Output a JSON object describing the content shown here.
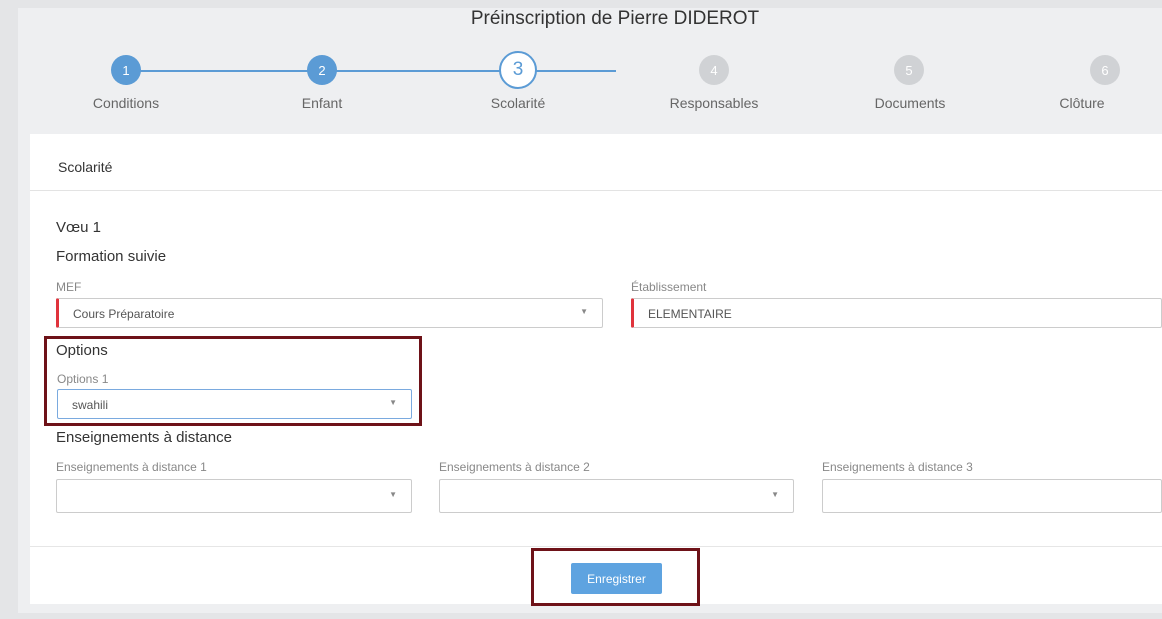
{
  "page": {
    "title": "Préinscription de Pierre DIDEROT"
  },
  "steps": [
    {
      "number": "1",
      "label": "Conditions",
      "state": "done"
    },
    {
      "number": "2",
      "label": "Enfant",
      "state": "done"
    },
    {
      "number": "3",
      "label": "Scolarité",
      "state": "current"
    },
    {
      "number": "4",
      "label": "Responsables",
      "state": "todo"
    },
    {
      "number": "5",
      "label": "Documents",
      "state": "todo"
    },
    {
      "number": "6",
      "label": "Clôture",
      "state": "todo"
    }
  ],
  "card": {
    "header": "Scolarité"
  },
  "voeu": {
    "title": "Vœu 1"
  },
  "formation": {
    "title": "Formation suivie",
    "mef_label": "MEF",
    "mef_value": "Cours Préparatoire",
    "etab_label": "Établissement",
    "etab_value": "ELEMENTAIRE"
  },
  "options": {
    "title": "Options",
    "label1": "Options 1",
    "value1": "swahili"
  },
  "distance": {
    "title": "Enseignements à distance",
    "label1": "Enseignements à distance 1",
    "label2": "Enseignements à distance 2",
    "label3": "Enseignements à distance 3",
    "value1": "",
    "value2": "",
    "value3": ""
  },
  "actions": {
    "save_label": "Enregistrer"
  },
  "colors": {
    "accent": "#5b9bd5",
    "highlight": "#6e1218",
    "required": "#e0333c",
    "button": "#5ea3e0"
  }
}
